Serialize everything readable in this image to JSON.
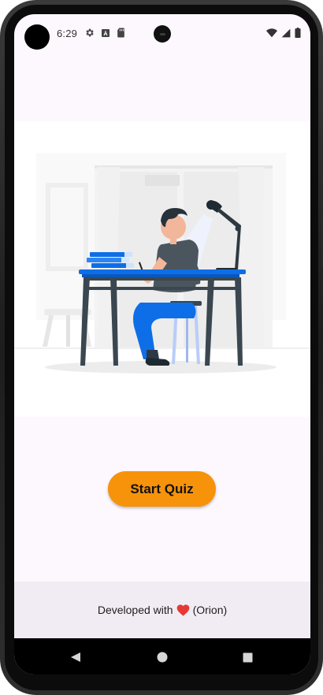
{
  "status_bar": {
    "time": "6:29",
    "left_icons": [
      "gear-icon",
      "font-a-icon",
      "sd-card-icon"
    ],
    "right_icons": [
      "wifi-icon",
      "signal-icon",
      "battery-icon"
    ]
  },
  "main": {
    "illustration": "person-studying-at-desk-illustration",
    "start_button_label": "Start Quiz"
  },
  "footer": {
    "prefix": "Developed with",
    "heart_icon": "heart-icon",
    "suffix": "(Orion)"
  },
  "nav_bar": {
    "buttons": [
      "back-icon",
      "home-icon",
      "recents-icon"
    ]
  },
  "colors": {
    "accent": "#f7930a",
    "background": "#fdf8fd",
    "footer_bg": "#f1ecf4",
    "desk_blue": "#0e6ee8",
    "heart": "#e53935"
  }
}
